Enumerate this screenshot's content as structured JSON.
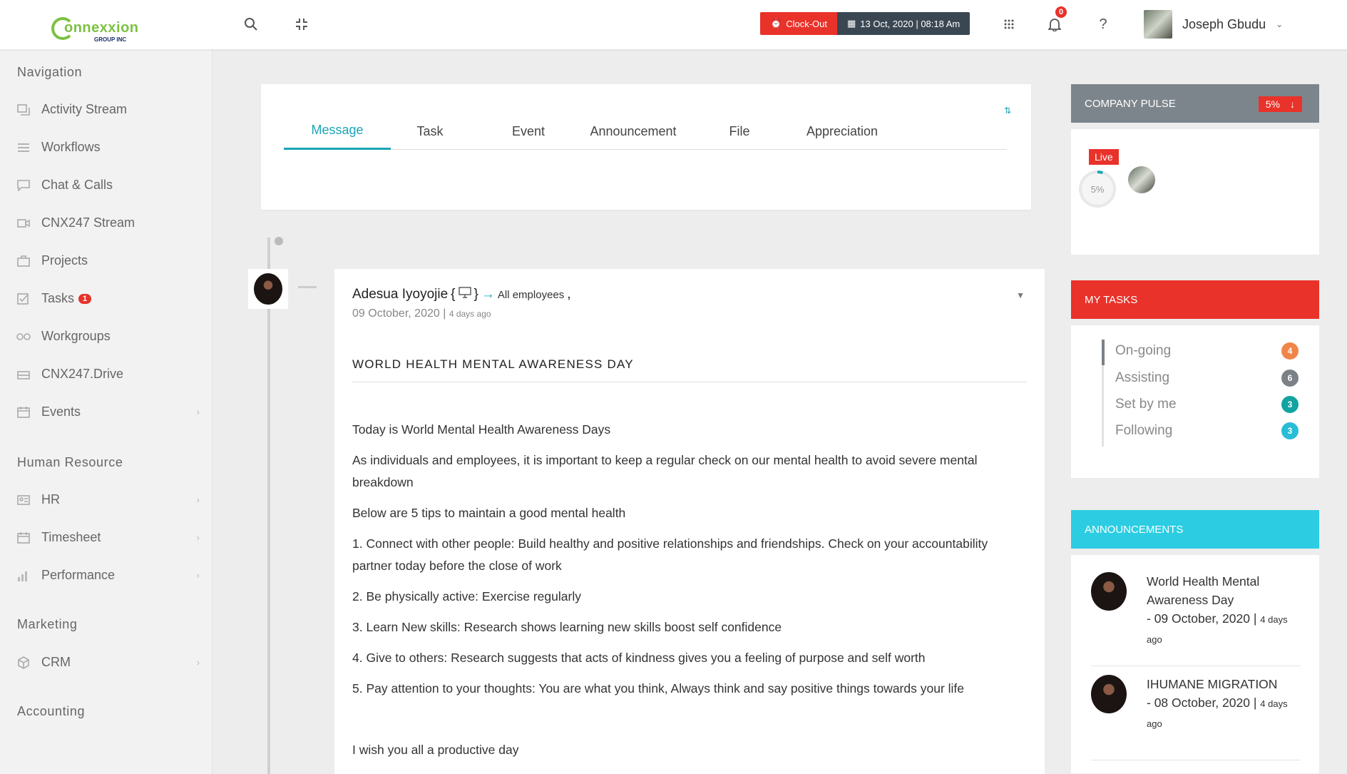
{
  "brand": {
    "logo_word": "onnexxion",
    "logo_sub": "GROUP INC"
  },
  "header": {
    "clock_out_label": "Clock-Out",
    "datetime": "13 Oct, 2020 | 08:18 Am",
    "notification_count": "0",
    "help_label": "?",
    "user_name": "Joseph Gbudu"
  },
  "sidebar": {
    "sections": {
      "navigation": "Navigation",
      "human_resource": "Human Resource",
      "marketing": "Marketing",
      "accounting": "Accounting"
    },
    "items": [
      {
        "label": "Activity Stream",
        "icon": "activity-stream-icon"
      },
      {
        "label": "Workflows",
        "icon": "workflows-icon"
      },
      {
        "label": "Chat & Calls",
        "icon": "chat-icon"
      },
      {
        "label": "CNX247 Stream",
        "icon": "stream-icon"
      },
      {
        "label": "Projects",
        "icon": "projects-icon"
      },
      {
        "label": "Tasks",
        "icon": "tasks-icon",
        "badge": "1"
      },
      {
        "label": "Workgroups",
        "icon": "workgroups-icon"
      },
      {
        "label": "CNX247.Drive",
        "icon": "drive-icon"
      },
      {
        "label": "Events",
        "icon": "events-icon"
      },
      {
        "label": "HR",
        "icon": "hr-icon"
      },
      {
        "label": "Timesheet",
        "icon": "timesheet-icon"
      },
      {
        "label": "Performance",
        "icon": "performance-icon"
      },
      {
        "label": "CRM",
        "icon": "crm-icon"
      }
    ]
  },
  "composer": {
    "tabs": [
      "Message",
      "Task",
      "Event",
      "Announcement",
      "File",
      "Appreciation"
    ],
    "active_tab": "Message"
  },
  "post": {
    "author": "Adesua Iyoyojie",
    "audience": "All employees",
    "date": "09 October, 2020",
    "ago": "4 days ago",
    "title": "WORLD HEALTH MENTAL AWARENESS DAY",
    "paragraphs": [
      "Today is World Mental Health Awareness Days",
      "As individuals and employees, it is important to keep a regular check on our mental health to avoid severe mental breakdown",
      "Below are 5 tips to maintain a good mental health",
      "1. Connect with other people: Build healthy and positive relationships and friendships. Check on your accountability partner today before the close of work",
      "2. Be physically active: Exercise regularly",
      "3. Learn New skills: Research shows learning new skills boost self confidence",
      "4. Give to others: Research suggests that acts of kindness gives you a feeling of purpose and self worth",
      "5. Pay attention to your thoughts: You are what you think, Always think and say positive things towards your life"
    ],
    "closing": "I wish you all a productive day"
  },
  "company_pulse": {
    "title": "COMPANY PULSE",
    "value": "5%",
    "trend": "down",
    "live_label": "Live",
    "gauge_label": "5%",
    "gauge_fraction": 0.05
  },
  "my_tasks": {
    "title": "MY TASKS",
    "rows": [
      {
        "label": "On-going",
        "count": "4",
        "color": "#f0854a"
      },
      {
        "label": "Assisting",
        "count": "6",
        "color": "#7b8187"
      },
      {
        "label": "Set by me",
        "count": "3",
        "color": "#13a3a1"
      },
      {
        "label": "Following",
        "count": "3",
        "color": "#29bdd6"
      }
    ]
  },
  "announcements": {
    "title": "ANNOUNCEMENTS",
    "items": [
      {
        "title": "World Health Mental Awareness Day",
        "date": "- 09 October, 2020",
        "ago": "4 days ago"
      },
      {
        "title": "IHUMANE MIGRATION",
        "date": "- 08 October, 2020",
        "ago": "4 days ago"
      }
    ]
  },
  "colors": {
    "accent": "#1aa5b8",
    "red": "#e8322a",
    "pulse_header": "#7d858c",
    "announce_header": "#2ccde2"
  }
}
